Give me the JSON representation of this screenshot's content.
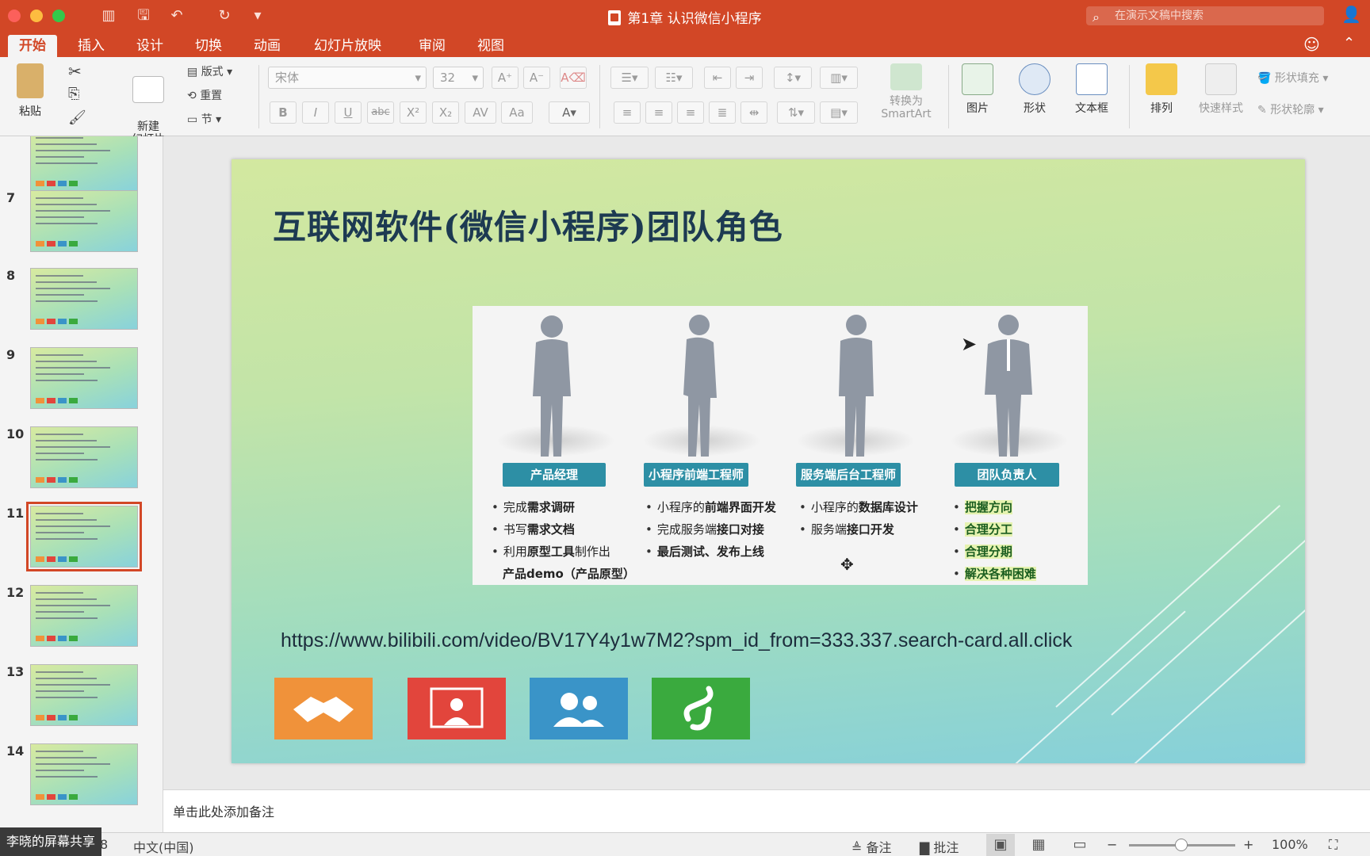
{
  "window": {
    "title": "第1章 认识微信小程序",
    "search_placeholder": "在演示文稿中搜索"
  },
  "tabs": [
    "开始",
    "插入",
    "设计",
    "切换",
    "动画",
    "幻灯片放映",
    "审阅",
    "视图"
  ],
  "ribbon": {
    "paste": "粘贴",
    "new_slide": "新建\n幻灯片",
    "layout": "版式",
    "reset": "重置",
    "section": "节",
    "font_name": "宋体",
    "font_size": "32",
    "convert_smartart": "转换为",
    "smartart": "SmartArt",
    "picture": "图片",
    "shape": "形状",
    "textbox": "文本框",
    "arrange": "排列",
    "quick_styles": "快速样式",
    "shape_fill": "形状填充",
    "shape_outline": "形状轮廓"
  },
  "thumbnails": [
    {
      "num": "7",
      "selected": false
    },
    {
      "num": "8",
      "selected": false
    },
    {
      "num": "9",
      "selected": false
    },
    {
      "num": "10",
      "selected": false
    },
    {
      "num": "11",
      "selected": true
    },
    {
      "num": "12",
      "selected": false
    },
    {
      "num": "13",
      "selected": false
    },
    {
      "num": "14",
      "selected": false
    }
  ],
  "slide": {
    "title": "互联网软件(微信小程序)团队角色",
    "roles": [
      {
        "name": "产品经理",
        "lines": [
          {
            "pre": "完成",
            "bold": "需求调研",
            "post": ""
          },
          {
            "pre": "书写",
            "bold": "需求文档",
            "post": ""
          },
          {
            "pre": "利用",
            "bold": "原型工具",
            "post": "制作出"
          },
          {
            "pre": "",
            "bold": "产品demo（产品原型）",
            "post": "",
            "cont": true
          }
        ]
      },
      {
        "name": "小程序前端工程师",
        "lines": [
          {
            "pre": "小程序的",
            "bold": "前端界面开发",
            "post": ""
          },
          {
            "pre": "完成服务端",
            "bold": "接口对接",
            "post": ""
          },
          {
            "pre": "",
            "bold": "最后测试、发布上线",
            "post": ""
          }
        ]
      },
      {
        "name": "服务端后台工程师",
        "lines": [
          {
            "pre": "小程序的",
            "bold": "数据库设计",
            "post": ""
          },
          {
            "pre": "服务端",
            "bold": "接口开发",
            "post": ""
          }
        ]
      },
      {
        "name": "团队负责人",
        "lines": [
          {
            "pre": "",
            "bold": "把握方向",
            "post": "",
            "hl": true
          },
          {
            "pre": "",
            "bold": "合理分工",
            "post": "",
            "hl": true
          },
          {
            "pre": "",
            "bold": "合理分期",
            "post": "",
            "hl": true
          },
          {
            "pre": "",
            "bold": "解决各种困难",
            "post": "",
            "hl": true
          }
        ]
      }
    ],
    "url": "https://www.bilibili.com/video/BV17Y4y1w7M2?spm_id_from=333.337.search-card.all.click",
    "tiles": [
      {
        "name": "handshake-icon",
        "color": "#f0923a"
      },
      {
        "name": "presenter-icon",
        "color": "#e2453c"
      },
      {
        "name": "team-icon",
        "color": "#3a94c8"
      },
      {
        "name": "miniprogram-icon",
        "color": "#3aaa3e"
      }
    ]
  },
  "notes": {
    "placeholder": "单击此处添加备注"
  },
  "status": {
    "slide_frag": "8",
    "language": "中文(中国)",
    "notes": "备注",
    "comments": "批注",
    "zoom": "100%"
  },
  "share_tag": "李晓的屏幕共享",
  "colors": {
    "accent": "#d24726",
    "badge": "#2d8fa5"
  }
}
